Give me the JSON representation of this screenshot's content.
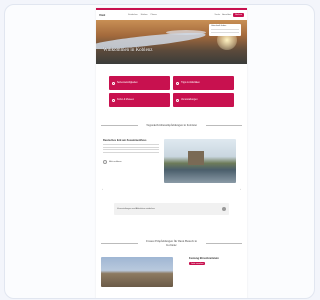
{
  "header": {
    "logo": "Visit",
    "nav": [
      "Entdecken",
      "Erleben",
      "Planen"
    ],
    "right": [
      "Suche",
      "Anmelden"
    ],
    "cta": "Buchen"
  },
  "hero": {
    "title": "Willkommen in Koblenz",
    "panel_title": "Unterkunft finden"
  },
  "tiles": [
    {
      "label": "Sehenswürdigkeiten",
      "icon": "landmark-icon"
    },
    {
      "label": "Tipps & Aktivitäten",
      "icon": "star-icon"
    },
    {
      "label": "Kultur & Museen",
      "icon": "museum-icon"
    },
    {
      "label": "Veranstaltungen",
      "icon": "calendar-icon"
    }
  ],
  "tips": {
    "section_title": "Tagesaktivitätenempfehlungen in Koblenz",
    "heading": "Deutsches Eck am Zusammenfluss",
    "more": "Mehr erfahren",
    "prev": "‹",
    "next": "›"
  },
  "search": {
    "label": "Veranstaltungen und Aktivitäten entdecken"
  },
  "events": {
    "section_title": "Unsere Empfehlungen für Ihren Besuch in Koblenz",
    "heading": "Festung Ehrenbreitstein",
    "badge": "Jetzt ansehen"
  },
  "colors": {
    "accent": "#c8114f",
    "background": "#f3f5fb"
  }
}
